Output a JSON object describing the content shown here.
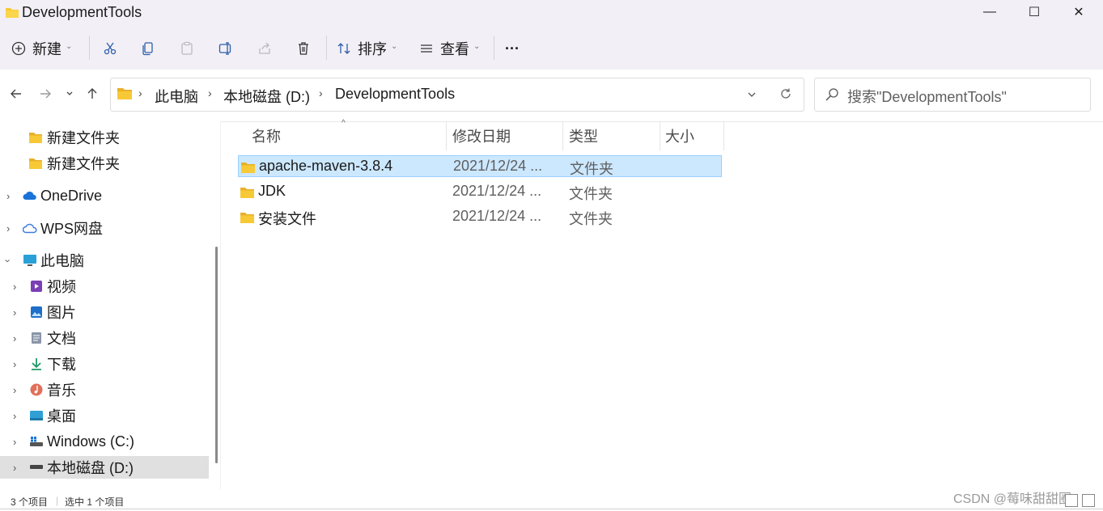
{
  "window": {
    "title": "DevelopmentTools",
    "controls": [
      "—",
      "☐",
      "✕"
    ]
  },
  "toolbar": {
    "new_label": "新建",
    "sort_label": "排序",
    "view_label": "查看",
    "more_label": "···"
  },
  "address": {
    "crumbs": [
      "此电脑",
      "本地磁盘 (D:)",
      "DevelopmentTools"
    ],
    "search_placeholder": "搜索\"DevelopmentTools\""
  },
  "sidebar": {
    "items": [
      {
        "label": "新建文件夹",
        "icon": "folder-icon"
      },
      {
        "label": "新建文件夹",
        "icon": "folder-icon"
      },
      {
        "label": "OneDrive",
        "icon": "cloud-icon"
      },
      {
        "label": "WPS网盘",
        "icon": "cloud-outline-icon"
      },
      {
        "label": "此电脑",
        "icon": "monitor-icon"
      },
      {
        "label": "视频",
        "icon": "video-icon"
      },
      {
        "label": "图片",
        "icon": "picture-icon"
      },
      {
        "label": "文档",
        "icon": "document-icon"
      },
      {
        "label": "下载",
        "icon": "download-icon"
      },
      {
        "label": "音乐",
        "icon": "music-icon"
      },
      {
        "label": "桌面",
        "icon": "desktop-icon"
      },
      {
        "label": "Windows (C:)",
        "icon": "windows-drive-icon"
      },
      {
        "label": "本地磁盘 (D:)",
        "icon": "drive-icon",
        "selected": true
      }
    ]
  },
  "columns": {
    "name": "名称",
    "date": "修改日期",
    "type": "类型",
    "size": "大小"
  },
  "files": [
    {
      "name": "apache-maven-3.8.4",
      "date": "2021/12/24 ...",
      "type": "文件夹",
      "selected": true
    },
    {
      "name": "JDK",
      "date": "2021/12/24 ...",
      "type": "文件夹"
    },
    {
      "name": "安装文件",
      "date": "2021/12/24 ...",
      "type": "文件夹"
    }
  ],
  "status": {
    "item_count": "3 个项目",
    "selected_count": "选中 1 个项目",
    "watermark": "CSDN @莓味甜甜圈"
  },
  "colors": {
    "chrome_bg": "#f3eff6",
    "selection_bg": "#cce8ff",
    "selection_border": "#99d1ff",
    "folder_yellow": "#f8c936"
  }
}
